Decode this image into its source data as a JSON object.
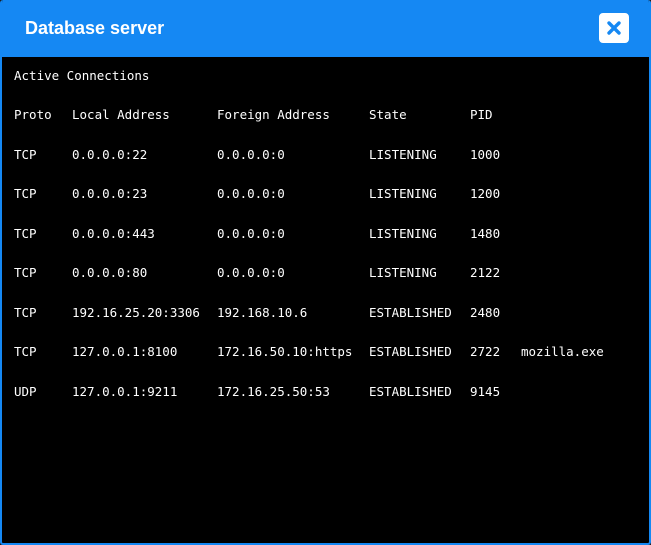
{
  "window": {
    "title": "Database server",
    "close_icon": "close-icon"
  },
  "colors": {
    "titlebar": "#1588f3",
    "terminal_bg": "#000000",
    "text": "#ffffff"
  },
  "terminal": {
    "heading": "Active Connections",
    "columns": [
      "Proto",
      "Local Address",
      "Foreign Address",
      "State",
      "PID"
    ],
    "rows": [
      {
        "proto": "TCP",
        "local": "0.0.0.0:22",
        "foreign": "0.0.0.0:0",
        "state": "LISTENING",
        "pid": "1000",
        "process": ""
      },
      {
        "proto": "TCP",
        "local": "0.0.0.0:23",
        "foreign": "0.0.0.0:0",
        "state": "LISTENING",
        "pid": "1200",
        "process": ""
      },
      {
        "proto": "TCP",
        "local": "0.0.0.0:443",
        "foreign": "0.0.0.0:0",
        "state": "LISTENING",
        "pid": "1480",
        "process": ""
      },
      {
        "proto": "TCP",
        "local": "0.0.0.0:80",
        "foreign": "0.0.0.0:0",
        "state": "LISTENING",
        "pid": "2122",
        "process": ""
      },
      {
        "proto": "TCP",
        "local": "192.16.25.20:3306",
        "foreign": "192.168.10.6",
        "state": "ESTABLISHED",
        "pid": "2480",
        "process": ""
      },
      {
        "proto": "TCP",
        "local": "127.0.0.1:8100",
        "foreign": "172.16.50.10:https",
        "state": "ESTABLISHED",
        "pid": "2722",
        "process": "mozilla.exe"
      },
      {
        "proto": "UDP",
        "local": "127.0.0.1:9211",
        "foreign": "172.16.25.50:53",
        "state": "ESTABLISHED",
        "pid": "9145",
        "process": ""
      }
    ]
  }
}
